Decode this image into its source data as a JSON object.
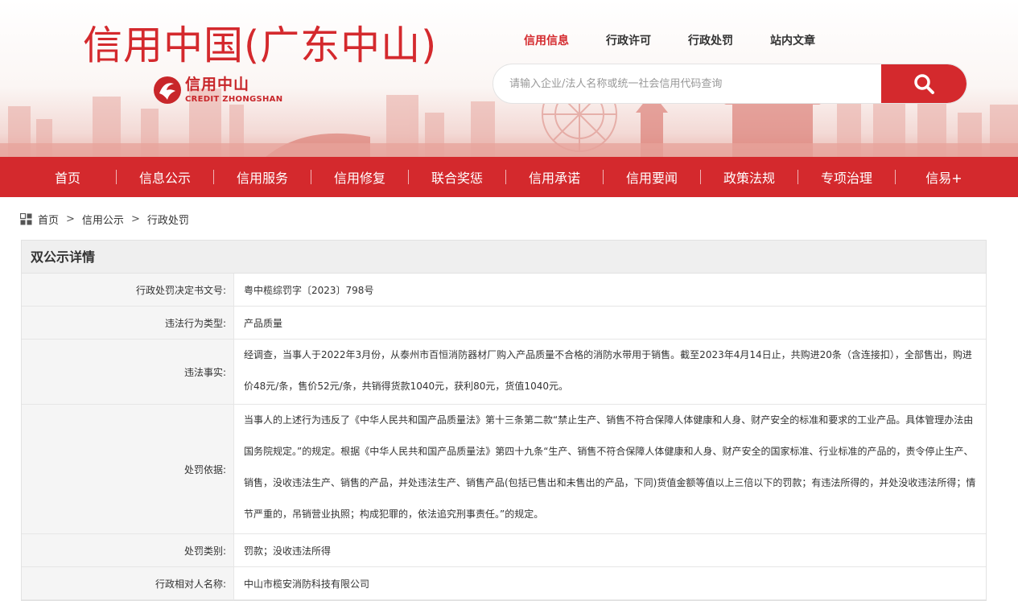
{
  "header": {
    "site_title": "信用中国(广东中山)",
    "logo_cn": "信用中山",
    "logo_en": "CREDIT ZHONGSHAN",
    "top_nav": [
      {
        "label": "信用信息",
        "active": true
      },
      {
        "label": "行政许可",
        "active": false
      },
      {
        "label": "行政处罚",
        "active": false
      },
      {
        "label": "站内文章",
        "active": false
      }
    ],
    "search": {
      "placeholder": "请输入企业/法人名称或统一社会信用代码查询",
      "value": "",
      "button_icon": "search-icon"
    }
  },
  "main_nav": [
    "首页",
    "信息公示",
    "信用服务",
    "信用修复",
    "联合奖惩",
    "信用承诺",
    "信用要闻",
    "政策法规",
    "专项治理",
    "信易+"
  ],
  "breadcrumb": {
    "icon": "grid-icon",
    "items": [
      "首页",
      "信用公示",
      "行政处罚"
    ],
    "separator": ">"
  },
  "detail": {
    "title": "双公示详情",
    "rows": [
      {
        "label": "行政处罚决定书文号:",
        "value": "粤中榄综罚字〔2023〕798号"
      },
      {
        "label": "违法行为类型:",
        "value": "产品质量"
      },
      {
        "label": "违法事实:",
        "value": "经调查，当事人于2022年3月份，从泰州市百恒消防器材厂购入产品质量不合格的消防水带用于销售。截至2023年4月14日止，共购进20条（含连接扣），全部售出，购进价48元/条，售价52元/条，共销得货款1040元，获利80元，货值1040元。"
      },
      {
        "label": "处罚依据:",
        "value": "当事人的上述行为违反了《中华人民共和国产品质量法》第十三条第二款“禁止生产、销售不符合保障人体健康和人身、财产安全的标准和要求的工业产品。具体管理办法由国务院规定。”的规定。根据《中华人民共和国产品质量法》第四十九条“生产、销售不符合保障人体健康和人身、财产安全的国家标准、行业标准的产品的，责令停止生产、销售，没收违法生产、销售的产品，并处违法生产、销售产品(包括已售出和未售出的产品，下同)货值金额等值以上三倍以下的罚款；有违法所得的，并处没收违法所得；情节严重的，吊销营业执照；构成犯罪的，依法追究刑事责任。”的规定。"
      },
      {
        "label": "处罚类别:",
        "value": "罚款；没收违法所得"
      },
      {
        "label": "行政相对人名称:",
        "value": "中山市榄安消防科技有限公司"
      }
    ]
  },
  "colors": {
    "brand_red": "#d4292d",
    "label_bg": "#f5f5f5",
    "title_bg": "#efefef"
  }
}
